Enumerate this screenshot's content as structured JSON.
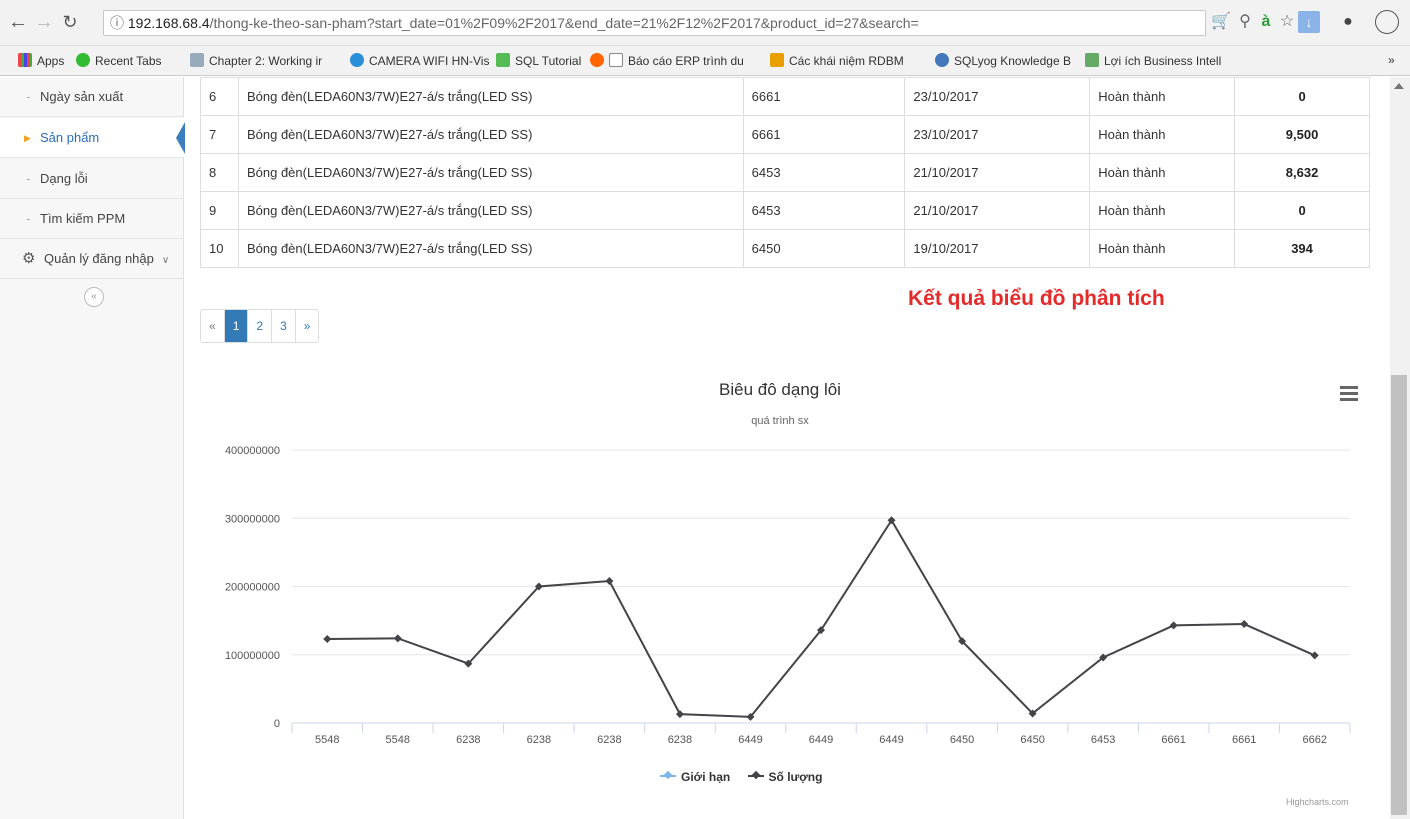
{
  "browser": {
    "url_host": "192.168.68.4",
    "url_path": "/thong-ke-theo-san-pham?start_date=01%2F09%2F2017&end_date=21%2F12%2F2017&product_id=27&search=",
    "bookmarks": [
      "Apps",
      "Recent Tabs",
      "Chapter 2: Working ir",
      "CAMERA WIFI HN-Vis",
      "SQL Tutorial",
      "Báo cáo ERP trình du",
      "Các khái niệm RDBM",
      "SQLyog Knowledge B",
      "Lợi ích Business Intell"
    ],
    "overflow": "»"
  },
  "sidebar": {
    "items": [
      "Ngày sản xuất",
      "Sản phẩm",
      "Dạng lỗi",
      "Tìm kiếm PPM"
    ],
    "active_index": 1,
    "group": "Quản lý đăng nhập",
    "collapse": "«"
  },
  "table": {
    "rows": [
      {
        "no": "6",
        "product": "Bóng đèn(LEDA60N3/7W)E27-á/s trắng(LED SS)",
        "code": "6661",
        "date": "23/10/2017",
        "status": "Hoàn thành",
        "qty": "0"
      },
      {
        "no": "7",
        "product": "Bóng đèn(LEDA60N3/7W)E27-á/s trắng(LED SS)",
        "code": "6661",
        "date": "23/10/2017",
        "status": "Hoàn thành",
        "qty": "9,500"
      },
      {
        "no": "8",
        "product": "Bóng đèn(LEDA60N3/7W)E27-á/s trắng(LED SS)",
        "code": "6453",
        "date": "21/10/2017",
        "status": "Hoàn thành",
        "qty": "8,632"
      },
      {
        "no": "9",
        "product": "Bóng đèn(LEDA60N3/7W)E27-á/s trắng(LED SS)",
        "code": "6453",
        "date": "21/10/2017",
        "status": "Hoàn thành",
        "qty": "0"
      },
      {
        "no": "10",
        "product": "Bóng đèn(LEDA60N3/7W)E27-á/s trắng(LED SS)",
        "code": "6450",
        "date": "19/10/2017",
        "status": "Hoàn thành",
        "qty": "394"
      }
    ]
  },
  "pagination": {
    "prev": "«",
    "pages": [
      "1",
      "2",
      "3"
    ],
    "active": "1",
    "next": "»"
  },
  "result_title": "Kết quả biểu đồ phân tích",
  "credit": "Highcharts.com",
  "chart_data": {
    "type": "line",
    "title": "Biêu đô dạng lôi",
    "subtitle": "quá trình sx",
    "categories": [
      "5548",
      "5548",
      "6238",
      "6238",
      "6238",
      "6238",
      "6449",
      "6449",
      "6449",
      "6450",
      "6450",
      "6453",
      "6661",
      "6661",
      "6662"
    ],
    "series": [
      {
        "name": "Giới hạn",
        "color": "#7cb5ec",
        "values": []
      },
      {
        "name": "Số lượng",
        "color": "#434348",
        "values": [
          123000000,
          124000000,
          87000000,
          200000000,
          208000000,
          13000000,
          9000000,
          136000000,
          297000000,
          120000000,
          14000000,
          96000000,
          143000000,
          145000000,
          99000000
        ]
      }
    ],
    "ylim": [
      0,
      400000000
    ],
    "yticks": [
      "0",
      "100000000",
      "200000000",
      "300000000",
      "400000000"
    ],
    "grid": true,
    "legend": "bottom-center"
  }
}
